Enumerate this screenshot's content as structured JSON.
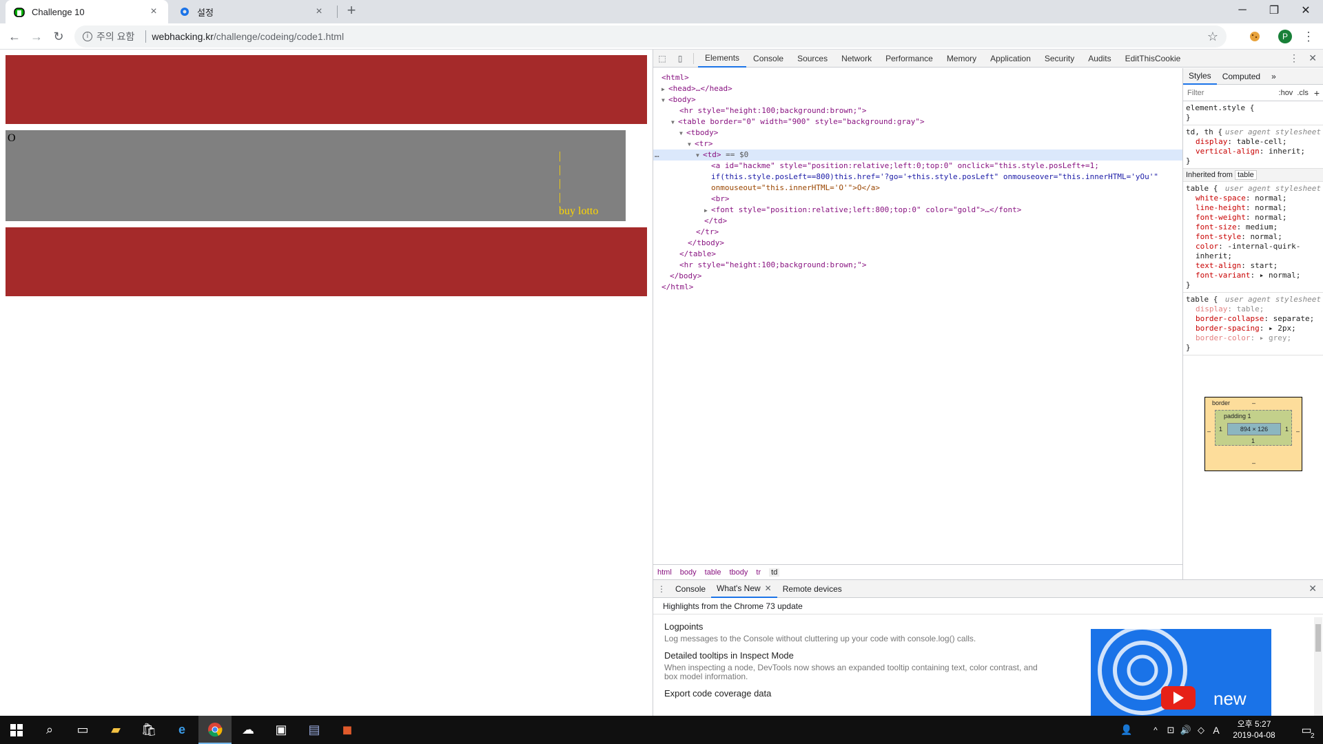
{
  "browser": {
    "tabs": [
      {
        "title": "Challenge 10",
        "active": true
      },
      {
        "title": "설정",
        "active": false
      }
    ],
    "new_tab_label": "+",
    "window_controls": {
      "minimize": "─",
      "restore": "❐",
      "close": "✕"
    },
    "omnibox": {
      "security_label": "주의 요함",
      "host": "webhacking.kr",
      "path": "/challenge/codeing/code1.html"
    },
    "profile_initial": "P"
  },
  "page": {
    "hackme_text": "O",
    "lotto_bars": [
      "|",
      "|",
      "|",
      "|"
    ],
    "lotto_text": "buy lotto",
    "colors": {
      "hr": "#a52a2a",
      "table": "#808080",
      "font": "gold"
    }
  },
  "devtools": {
    "tabs": [
      "Elements",
      "Console",
      "Sources",
      "Network",
      "Performance",
      "Memory",
      "Application",
      "Security",
      "Audits",
      "EditThisCookie"
    ],
    "selected_tab": "Elements",
    "dom": {
      "html_open": "<html>",
      "head": "<head>…</head>",
      "body_open": "<body>",
      "hr1": "<hr style=\"height:100;background:brown;\">",
      "table_open": "<table border=\"0\" width=\"900\" style=\"background:gray\">",
      "tbody_open": "<tbody>",
      "tr_open": "<tr>",
      "td_open": "<td>",
      "td_marker": " == $0",
      "a_line1": "<a id=\"hackme\" style=\"position:relative;left:0;top:0\" onclick=\"this.style.posLeft+=1;",
      "a_line2": "if(this.style.posLeft==800)this.href='?go='+this.style.posLeft\" onmouseover=\"this.innerHTML='yOu'\"",
      "a_line3": "onmouseout=\"this.innerHTML='O'\">O</a>",
      "br": "<br>",
      "font": "<font style=\"position:relative;left:800;top:0\" color=\"gold\">…</font>",
      "td_close": "</td>",
      "tr_close": "</tr>",
      "tbody_close": "</tbody>",
      "table_close": "</table>",
      "hr2": "<hr style=\"height:100;background:brown;\">",
      "body_close": "</body>",
      "html_close": "</html>",
      "ellipsis": "…"
    },
    "breadcrumbs": [
      "html",
      "body",
      "table",
      "tbody",
      "tr",
      "td"
    ],
    "styles": {
      "tabs": [
        "Styles",
        "Computed"
      ],
      "more": "»",
      "filter_placeholder": "Filter",
      "hov": ":hov",
      "cls": ".cls",
      "add": "+",
      "element_style": "element.style {",
      "close_brace": "}",
      "rule1": {
        "selector": "td, th {",
        "origin": "user agent stylesheet",
        "props": [
          {
            "n": "display",
            "v": "table-cell;"
          },
          {
            "n": "vertical-align",
            "v": "inherit;"
          }
        ]
      },
      "inherited_label": "Inherited from",
      "inherited_tag": "table",
      "rule2": {
        "selector": "table {",
        "origin": "user agent stylesheet",
        "props": [
          {
            "n": "white-space",
            "v": "normal;"
          },
          {
            "n": "line-height",
            "v": "normal;"
          },
          {
            "n": "font-weight",
            "v": "normal;"
          },
          {
            "n": "font-size",
            "v": "medium;"
          },
          {
            "n": "font-style",
            "v": "normal;"
          },
          {
            "n": "color",
            "v": "-internal-quirk-inherit;"
          },
          {
            "n": "text-align",
            "v": "start;"
          },
          {
            "n": "font-variant",
            "v": "▸ normal;"
          }
        ]
      },
      "rule3": {
        "selector": "table {",
        "origin": "user agent stylesheet",
        "props": [
          {
            "n": "display",
            "v": "table;"
          },
          {
            "n": "border-collapse",
            "v": "separate;"
          },
          {
            "n": "border-spacing",
            "v": "▸ 2px;"
          },
          {
            "n": "border-color",
            "v": "▸ grey;"
          }
        ]
      }
    },
    "box_model": {
      "border_label": "border",
      "border_val": "–",
      "padding_label": "padding 1",
      "content": "894 × 126",
      "side": "1",
      "bottom": "1",
      "dash": "–"
    },
    "drawer": {
      "tabs": [
        "Console",
        "What's New",
        "Remote devices"
      ],
      "selected": "What's New",
      "highlights": "Highlights from the Chrome 73 update",
      "items": [
        {
          "title": "Logpoints",
          "desc": "Log messages to the Console without cluttering up your code with console.log() calls."
        },
        {
          "title": "Detailed tooltips in Inspect Mode",
          "desc": "When inspecting a node, DevTools now shows an expanded tooltip containing text, color contrast, and box model information."
        },
        {
          "title": "Export code coverage data",
          "desc": ""
        }
      ],
      "image_text": "new"
    }
  },
  "taskbar": {
    "time": "오후 5:27",
    "date": "2019-04-08",
    "ime": "A",
    "notif_count": "2"
  }
}
